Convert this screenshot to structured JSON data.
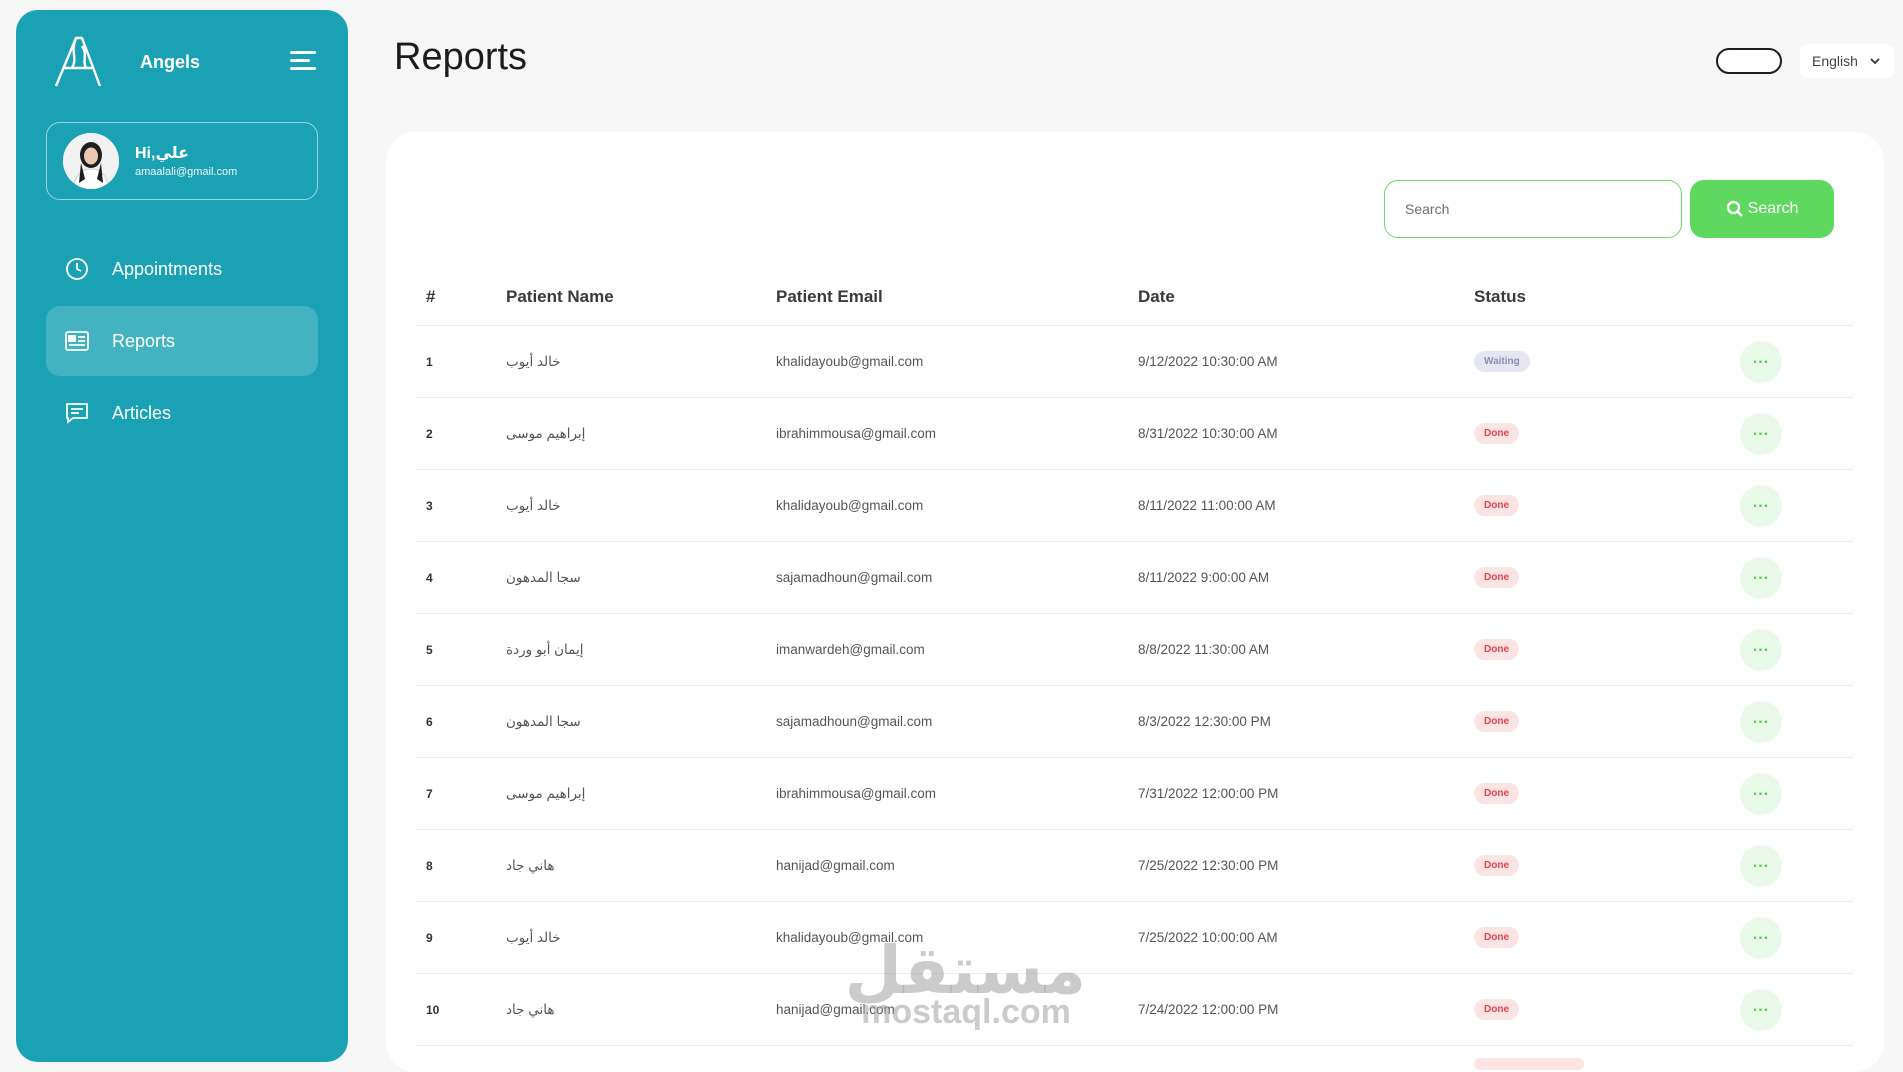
{
  "brand": {
    "name": "Angels"
  },
  "profile": {
    "greeting": "Hi,علي",
    "email": "amaalali@gmail.com"
  },
  "nav": {
    "items": [
      {
        "label": "Appointments",
        "icon": "clock-icon",
        "active": false
      },
      {
        "label": "Reports",
        "icon": "report-icon",
        "active": true
      },
      {
        "label": "Articles",
        "icon": "article-icon",
        "active": false
      }
    ]
  },
  "header": {
    "title": "Reports",
    "language": "English"
  },
  "search": {
    "placeholder": "Search",
    "button_label": "Search"
  },
  "table": {
    "columns": [
      "#",
      "Patient Name",
      "Patient Email",
      "Date",
      "Status"
    ],
    "rows": [
      {
        "num": "1",
        "name": "خالد أيوب",
        "email": "khalidayoub@gmail.com",
        "date": "9/12/2022 10:30:00 AM",
        "status": "Waiting"
      },
      {
        "num": "2",
        "name": "إبراهيم موسى",
        "email": "ibrahimmousa@gmail.com",
        "date": "8/31/2022 10:30:00 AM",
        "status": "Done"
      },
      {
        "num": "3",
        "name": "خالد أيوب",
        "email": "khalidayoub@gmail.com",
        "date": "8/11/2022 11:00:00 AM",
        "status": "Done"
      },
      {
        "num": "4",
        "name": "سجا المدهون",
        "email": "sajamadhoun@gmail.com",
        "date": "8/11/2022 9:00:00 AM",
        "status": "Done"
      },
      {
        "num": "5",
        "name": "إيمان أبو وردة",
        "email": "imanwardeh@gmail.com",
        "date": "8/8/2022 11:30:00 AM",
        "status": "Done"
      },
      {
        "num": "6",
        "name": "سجا المدهون",
        "email": "sajamadhoun@gmail.com",
        "date": "8/3/2022 12:30:00 PM",
        "status": "Done"
      },
      {
        "num": "7",
        "name": "إبراهيم موسى",
        "email": "ibrahimmousa@gmail.com",
        "date": "7/31/2022 12:00:00 PM",
        "status": "Done"
      },
      {
        "num": "8",
        "name": "هاني جاد",
        "email": "hanijad@gmail.com",
        "date": "7/25/2022 12:30:00 PM",
        "status": "Done"
      },
      {
        "num": "9",
        "name": "خالد أيوب",
        "email": "khalidayoub@gmail.com",
        "date": "7/25/2022 10:00:00 AM",
        "status": "Done"
      },
      {
        "num": "10",
        "name": "هاني جاد",
        "email": "hanijad@gmail.com",
        "date": "7/24/2022 12:00:00 PM",
        "status": "Done"
      }
    ],
    "action_label": "..."
  },
  "watermark": {
    "arabic": "مستقل",
    "latin": "mostaql.com"
  },
  "colors": {
    "sidebar": "#1aa1b4",
    "accent_green": "#5fd85f",
    "done_badge": "#e0454a",
    "waiting_badge": "#8a8fb5"
  }
}
